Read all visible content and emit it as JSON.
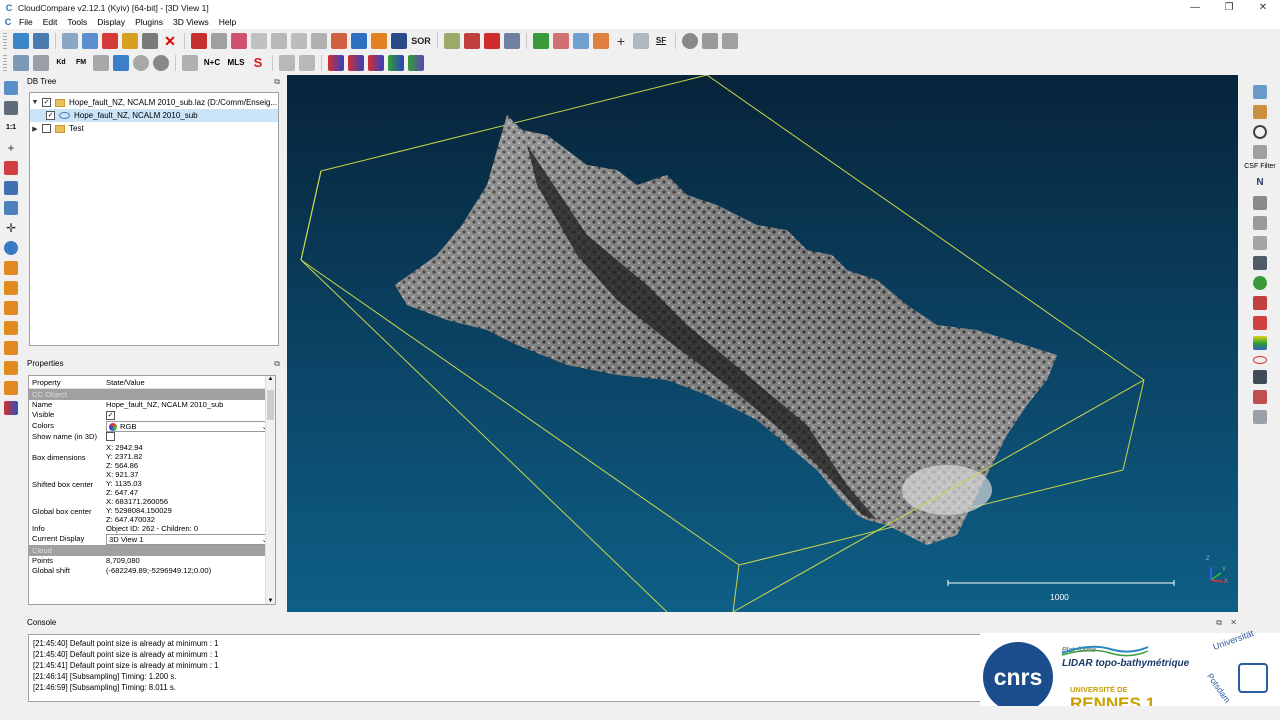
{
  "window": {
    "title": "CloudCompare v2.12.1 (Kyiv) [64-bit] - [3D View 1]"
  },
  "menu": [
    "File",
    "Edit",
    "Tools",
    "Display",
    "Plugins",
    "3D Views",
    "Help"
  ],
  "toolbar_labels": {
    "sor": "SOR",
    "nc": "N+C",
    "mls": "MLS",
    "kd": "Kd",
    "fm": "FM",
    "sf": "SF"
  },
  "db_tree": {
    "header": "DB Tree",
    "items": [
      {
        "label": "Hope_fault_NZ, NCALM 2010_sub.laz (D:/Comm/Enseig...",
        "level": 0,
        "checked": true,
        "expanded": true
      },
      {
        "label": "Hope_fault_NZ, NCALM 2010_sub",
        "level": 1,
        "checked": true,
        "selected": true
      },
      {
        "label": "Test",
        "level": 0,
        "checked": false,
        "expanded": false
      }
    ]
  },
  "properties": {
    "header": "Properties",
    "col_property": "Property",
    "col_value": "State/Value",
    "section_ccobject": "CC Object",
    "name_label": "Name",
    "name_value": "Hope_fault_NZ, NCALM 2010_sub",
    "visible_label": "Visible",
    "colors_label": "Colors",
    "colors_value": "RGB",
    "showname_label": "Show name (in 3D)",
    "boxdim_label": "Box dimensions",
    "boxdim_x": "X: 2942.94",
    "boxdim_y": "Y: 2371.82",
    "boxdim_z": "Z: 564.86",
    "shifted_label": "Shifted box center",
    "shifted_x": "X: 921.37",
    "shifted_y": "Y: 1135.03",
    "shifted_z": "Z: 647.47",
    "global_label": "Global box center",
    "global_x": "X: 683171.260056",
    "global_y": "Y: 5298084.150029",
    "global_z": "Z: 647.470032",
    "info_label": "Info",
    "info_value": "Object ID: 262 - Children: 0",
    "display_label": "Current Display",
    "display_value": "3D View 1",
    "section_cloud": "Cloud",
    "points_label": "Points",
    "points_value": "8,709,080",
    "shift_label": "Global shift",
    "shift_value": "(-682249.89;-5296949.12;0.00)"
  },
  "view3d": {
    "scale_label": "1000",
    "axis_z": "Z",
    "axis_y": "Y",
    "axis_x": "X"
  },
  "right_toolbar": {
    "csf_label": "CSF Filter"
  },
  "console": {
    "header": "Console",
    "lines": [
      "[21:45:40] Default point size is already at minimum : 1",
      "[21:45:40] Default point size is already at minimum : 1",
      "[21:45:41] Default point size is already at minimum : 1",
      "[21:46:14] [Subsampling] Timing: 1.200 s.",
      "[21:46:59] [Subsampling] Timing: 8.011 s."
    ]
  },
  "logos": {
    "cnrs": "cnrs",
    "lidar_line1": "Plateforme",
    "lidar_line2": "LIDAR topo-bathymétrique",
    "rennes_line1": "UNIVERSITÉ DE",
    "rennes_line2": "RENNES 1",
    "potsdam_line1": "Universität",
    "potsdam_line2": "Potsdam"
  }
}
